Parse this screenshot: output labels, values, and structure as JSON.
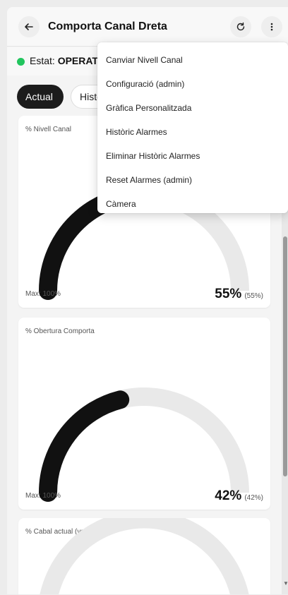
{
  "header": {
    "title": "Comporta Canal Dreta",
    "back_icon": "arrow-left-icon",
    "refresh_icon": "refresh-icon",
    "more_icon": "more-vertical-icon"
  },
  "status": {
    "label": "Estat:",
    "value": "OPERATIU",
    "dot_color": "#22c55e"
  },
  "tabs": [
    {
      "label": "Actual",
      "active": true
    },
    {
      "label": "Històric",
      "active": false
    }
  ],
  "gauges": [
    {
      "title": "% Nivell Canal",
      "max_label": "Max: 100%",
      "value": "55%",
      "sub": "(55%)",
      "fraction": 0.55
    },
    {
      "title": "% Obertura Comporta",
      "max_label": "Max: 100%",
      "value": "42%",
      "sub": "(42%)",
      "fraction": 0.42
    },
    {
      "title": "% Cabal actual (vs màx)"
    }
  ],
  "menu": {
    "items": [
      "Canviar Nivell Canal",
      "Configuració (admin)",
      "Gràfica Personalitzada",
      "Històric Alarmes",
      "Eliminar Històric Alarmes",
      "Reset Alarmes (admin)",
      "Càmera"
    ]
  },
  "colors": {
    "gauge_fill": "#111111",
    "gauge_track": "#e9e9e9",
    "accent_dark": "#1c1c1c"
  }
}
